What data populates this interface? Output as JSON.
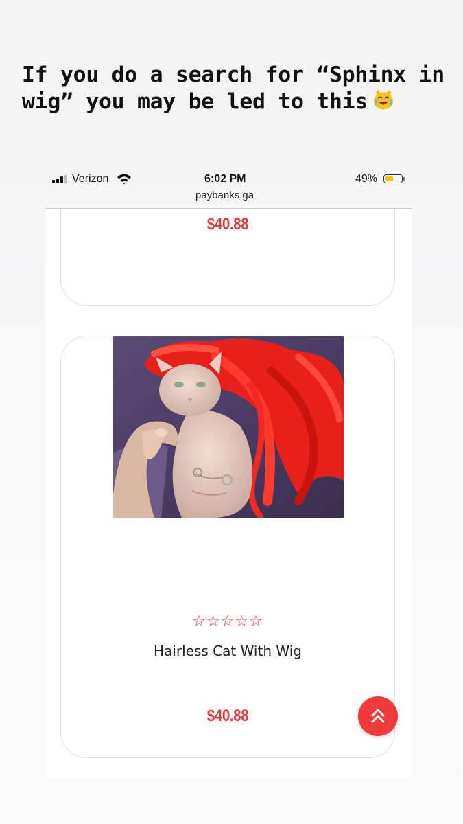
{
  "story": {
    "caption": "If you do a search for “Sphinx in wig” you may be led to this",
    "emoji": "cat-face-with-tears-of-joy-icon"
  },
  "status_bar": {
    "carrier": "Verizon",
    "time": "6:02 PM",
    "url": "paybanks.ga",
    "battery_percent": "49%",
    "battery_level": 0.49
  },
  "product_cards": [
    {
      "price": "$40.88"
    },
    {
      "image": "hairless-cat-with-red-wig-photo",
      "rating_stars": "☆☆☆☆☆",
      "title": "Hairless Cat With Wig",
      "price": "$40.88"
    }
  ],
  "scroll_top": {
    "icon": "double-chevron-up-icon"
  },
  "colors": {
    "accent": "#e03a3c",
    "button": "#ef3b3c",
    "battery": "#f2c300"
  }
}
